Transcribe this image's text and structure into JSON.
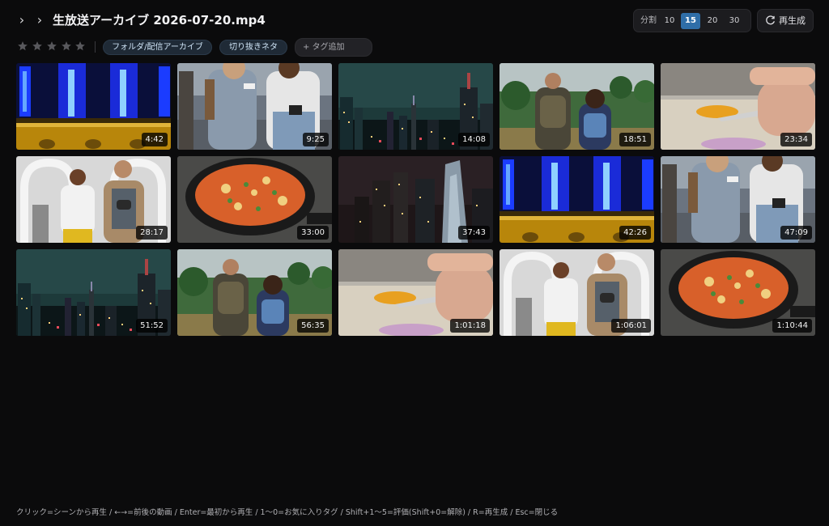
{
  "header": {
    "title": "生放送アーカイブ 2026-07-20.mp4",
    "split": {
      "label": "分割",
      "options": [
        "10",
        "15",
        "20",
        "30"
      ],
      "selected": "15"
    },
    "regenerate_label": "再生成"
  },
  "rating": {
    "stars_filled": 0,
    "stars_total": 5
  },
  "tags": [
    "フォルダ/配信アーカイブ",
    "切り抜きネタ"
  ],
  "tag_input": {
    "placeholder": "+ タグ追加"
  },
  "scenes": [
    {
      "duration": "4:42",
      "thumb": "blue-stage"
    },
    {
      "duration": "9:25",
      "thumb": "tourists-crowd"
    },
    {
      "duration": "14:08",
      "thumb": "night-city-teal"
    },
    {
      "duration": "18:51",
      "thumb": "hikers-back"
    },
    {
      "duration": "23:34",
      "thumb": "hand-knife-cooking"
    },
    {
      "duration": "28:17",
      "thumb": "couple-arches"
    },
    {
      "duration": "33:00",
      "thumb": "paella-pan"
    },
    {
      "duration": "37:43",
      "thumb": "night-skyscrapers"
    },
    {
      "duration": "42:26",
      "thumb": "blue-stage"
    },
    {
      "duration": "47:09",
      "thumb": "tourists-crowd"
    },
    {
      "duration": "51:52",
      "thumb": "night-city-teal"
    },
    {
      "duration": "56:35",
      "thumb": "hikers-back"
    },
    {
      "duration": "1:01:18",
      "thumb": "hand-knife-cooking"
    },
    {
      "duration": "1:06:01",
      "thumb": "couple-arches"
    },
    {
      "duration": "1:10:44",
      "thumb": "paella-pan"
    }
  ],
  "footer": {
    "hint": "クリック=シーンから再生 / ←→=前後の動画 / Enter=最初から再生 / 1〜0=お気に入りタグ / Shift+1〜5=評価(Shift+0=解除) / R=再生成 / Esc=閉じる"
  },
  "colors": {
    "accent": "#2f6ea8",
    "tag_bg": "#1f2a36",
    "background": "#0b0b0c"
  }
}
